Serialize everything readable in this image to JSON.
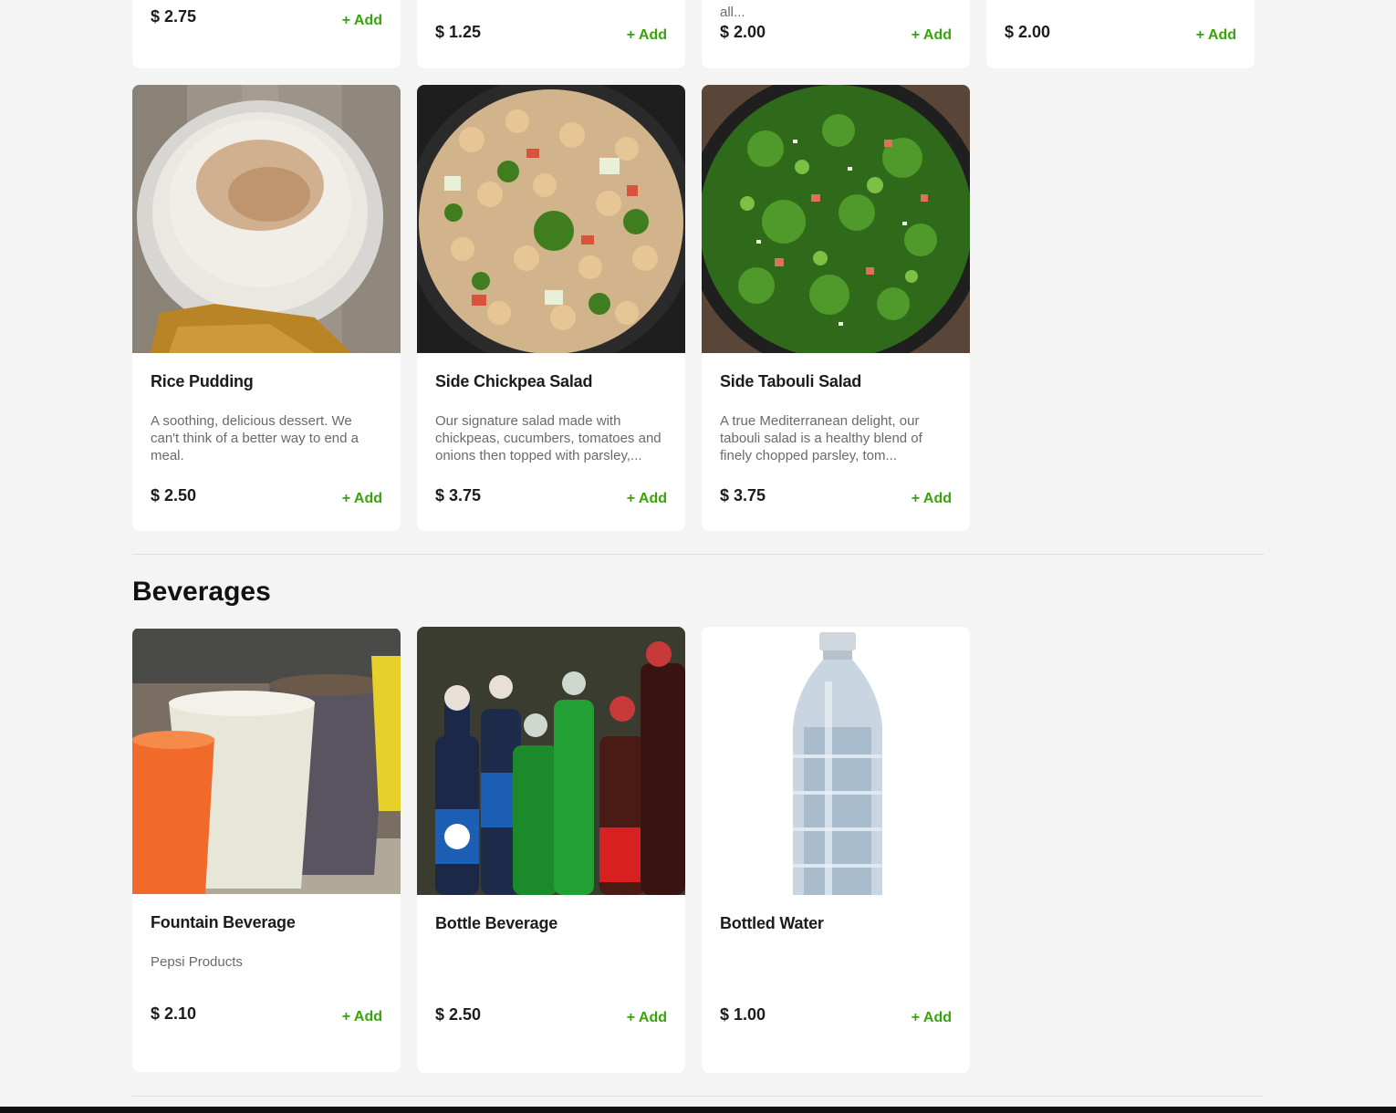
{
  "common": {
    "add_label": "+ Add"
  },
  "top_row": [
    {
      "price": "$ 2.75"
    },
    {
      "price": "$ 1.25"
    },
    {
      "desc_tail": "all...",
      "price": "$ 2.00"
    },
    {
      "price": "$ 2.00"
    }
  ],
  "desserts_sides": [
    {
      "name": "Rice Pudding",
      "description": "A soothing, delicious dessert. We can't think of a better way to end a meal.",
      "price": "$ 2.50",
      "image_icon": "rice-pudding-photo"
    },
    {
      "name": "Side Chickpea Salad",
      "description": "Our signature salad made with chickpeas, cucumbers, tomatoes and onions then topped with parsley,...",
      "price": "$ 3.75",
      "image_icon": "chickpea-salad-photo"
    },
    {
      "name": "Side Tabouli Salad",
      "description": "A true Mediterranean delight, our tabouli salad is a healthy blend of finely chopped parsley, tom...",
      "price": "$ 3.75",
      "image_icon": "tabouli-salad-photo"
    }
  ],
  "beverages": {
    "title": "Beverages",
    "items": [
      {
        "name": "Fountain Beverage",
        "description": "Pepsi Products",
        "price": "$ 2.10",
        "image_icon": "fountain-drinks-photo"
      },
      {
        "name": "Bottle Beverage",
        "description": "",
        "price": "$ 2.50",
        "image_icon": "glass-bottles-photo"
      },
      {
        "name": "Bottled Water",
        "description": "",
        "price": "$ 1.00",
        "image_icon": "water-bottle-photo"
      }
    ]
  },
  "colors": {
    "accent_green": "#3aa30b",
    "page_bg": "#f4f4f4",
    "card_bg": "#ffffff"
  }
}
